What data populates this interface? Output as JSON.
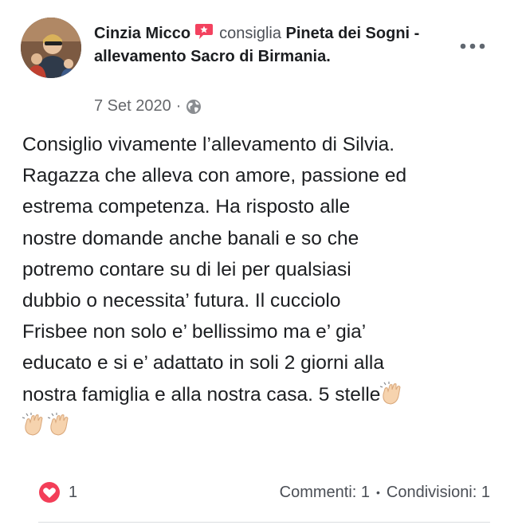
{
  "post": {
    "author": "Cinzia Micco",
    "verb": "consiglia",
    "page_name": "Pineta dei Sogni - allevamento Sacro di Birmania",
    "page_suffix": ".",
    "date": "7 Set 2020",
    "date_sep": "·",
    "body_lines": [
      "Consiglio vivamente l’allevamento di Silvia.",
      "Ragazza che alleva con amore, passione ed",
      "estrema competenza. Ha risposto alle",
      "nostre domande anche banali e so che",
      "potremo contare su di lei per qualsiasi",
      "dubbio o necessita’ futura. Il cucciolo",
      "Frisbee non solo e’ bellissimo ma e’ gia’",
      "educato e si e’ adattato in soli 2 giorni alla",
      "nostra famiglia e alla nostra casa. 5 stelle"
    ],
    "emoji": [
      "clapping-hands",
      "clapping-hands",
      "clapping-hands"
    ]
  },
  "footer": {
    "reaction_count": "1",
    "comments": "Commenti: 1",
    "separator": "•",
    "shares": "Condivisioni: 1"
  },
  "colors": {
    "heart_red": "#f33e58",
    "recommend_badge": "#f3425f",
    "muted_text": "#65676b",
    "clap_skin": "#f6d3ae"
  }
}
